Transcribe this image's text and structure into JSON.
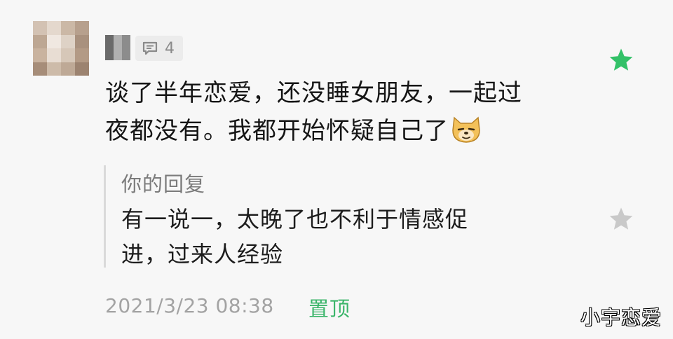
{
  "comment": {
    "avatar_icon": "blurred-avatar",
    "reply_count": "4",
    "reply_icon": "speech-bubble-icon",
    "text_line1": "谈了半年恋爱，还没睡女朋友，一起过",
    "text_line2": "夜都没有。我都开始怀疑自己了",
    "emoji": "dog-face-emoji",
    "favorite_state": "starred",
    "favorite_color": "#33c168"
  },
  "reply": {
    "label": "你的回复",
    "text_line1": "有一说一，太晚了也不利于情感促",
    "text_line2": "进，过来人经验",
    "favorite_state": "unstarred",
    "favorite_color": "#c9c9c9"
  },
  "footer": {
    "timestamp": "2021/3/23 08:38",
    "pin_label": "置顶",
    "pin_color": "#3bb56a"
  },
  "watermark": "小宇恋爱"
}
